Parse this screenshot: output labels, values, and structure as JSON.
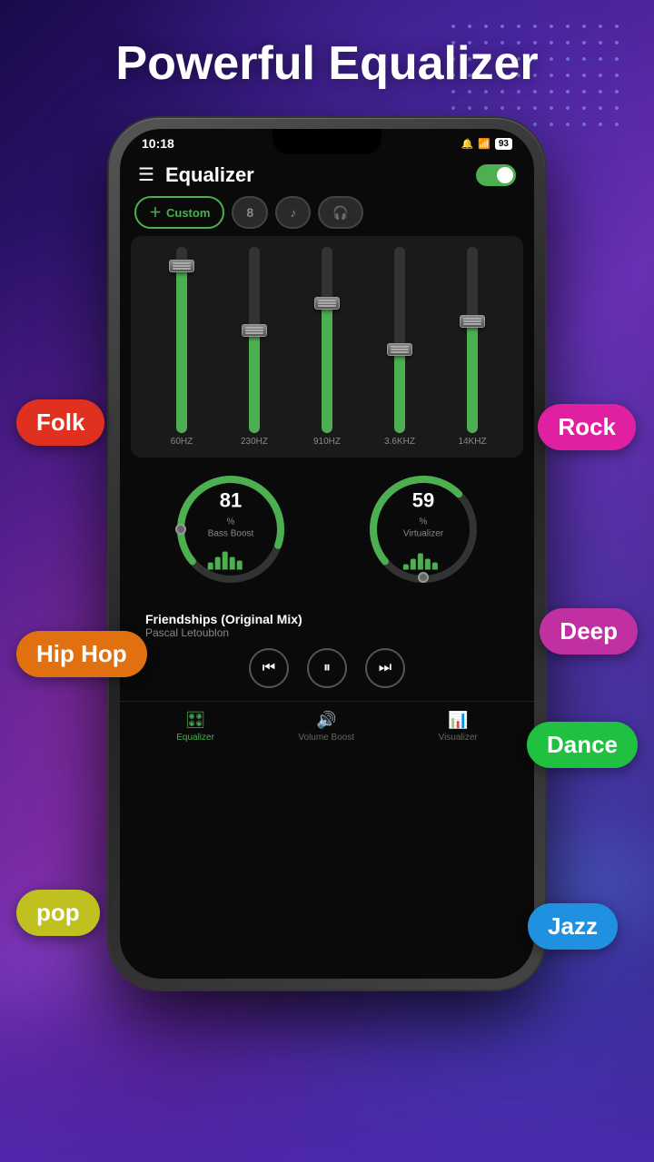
{
  "page": {
    "title": "Powerful Equalizer",
    "background": "#2a1a6a"
  },
  "status_bar": {
    "time": "10:18",
    "battery": "93",
    "icons": [
      "🔔",
      "📶"
    ]
  },
  "header": {
    "title": "Equalizer",
    "menu_icon": "☰",
    "toggle_on": true
  },
  "preset_tabs": [
    {
      "id": "custom",
      "label": "Custom",
      "icon": "＋",
      "active": true
    },
    {
      "id": "preset2",
      "label": "8",
      "icon": "8",
      "active": false
    },
    {
      "id": "preset3",
      "label": "♪",
      "icon": "♪",
      "active": false
    },
    {
      "id": "preset4",
      "label": "🎧",
      "icon": "🎧",
      "active": false
    }
  ],
  "equalizer": {
    "bands": [
      {
        "freq": "60HZ",
        "fill_pct": 90,
        "handle_pct": 10
      },
      {
        "freq": "230HZ",
        "fill_pct": 55,
        "handle_pct": 45
      },
      {
        "freq": "910HZ",
        "fill_pct": 70,
        "handle_pct": 30
      },
      {
        "freq": "3.6KHZ",
        "fill_pct": 45,
        "handle_pct": 55
      },
      {
        "freq": "14KHZ",
        "fill_pct": 60,
        "handle_pct": 40
      }
    ]
  },
  "knobs": {
    "bass_boost": {
      "label": "Bass Boost",
      "value": 81,
      "unit": "%"
    },
    "virtualizer": {
      "label": "Virtualizer",
      "value": 59,
      "unit": "%"
    }
  },
  "player": {
    "song_title": "Friendships (Original Mix)",
    "artist": "Pascal Letoublon",
    "controls": {
      "prev": "⏮",
      "pause": "⏸",
      "next": "⏭"
    }
  },
  "bottom_nav": [
    {
      "id": "equalizer",
      "label": "Equalizer",
      "icon": "🎛",
      "active": true
    },
    {
      "id": "volume",
      "label": "Volume Boost",
      "icon": "🔊",
      "active": false
    },
    {
      "id": "visualizer",
      "label": "Visualizer",
      "icon": "📊",
      "active": false
    }
  ],
  "genre_badges": {
    "folk": "Folk",
    "rock": "Rock",
    "hiphop": "Hip Hop",
    "deep": "Deep",
    "dance": "Dance",
    "pop": "pop",
    "jazz": "Jazz"
  }
}
